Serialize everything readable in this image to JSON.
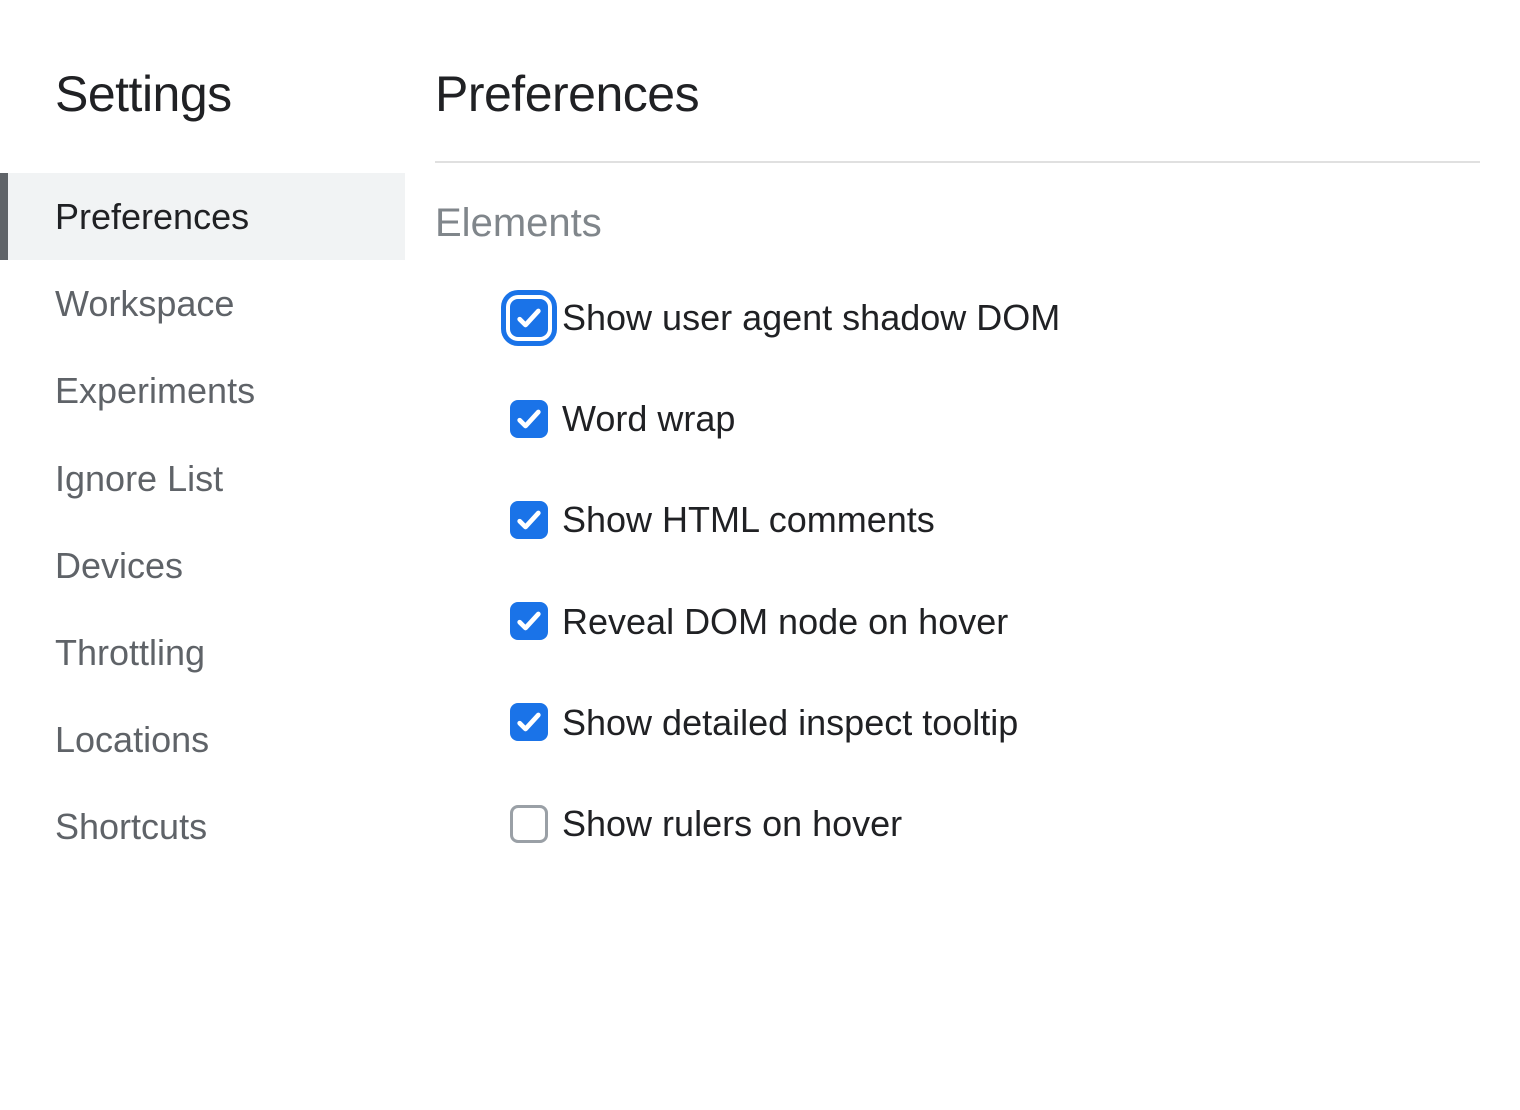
{
  "sidebar": {
    "title": "Settings",
    "items": [
      {
        "label": "Preferences",
        "active": true
      },
      {
        "label": "Workspace",
        "active": false
      },
      {
        "label": "Experiments",
        "active": false
      },
      {
        "label": "Ignore List",
        "active": false
      },
      {
        "label": "Devices",
        "active": false
      },
      {
        "label": "Throttling",
        "active": false
      },
      {
        "label": "Locations",
        "active": false
      },
      {
        "label": "Shortcuts",
        "active": false
      }
    ]
  },
  "main": {
    "title": "Preferences",
    "section": {
      "title": "Elements",
      "options": [
        {
          "label": "Show user agent shadow DOM",
          "checked": true,
          "focused": true
        },
        {
          "label": "Word wrap",
          "checked": true,
          "focused": false
        },
        {
          "label": "Show HTML comments",
          "checked": true,
          "focused": false
        },
        {
          "label": "Reveal DOM node on hover",
          "checked": true,
          "focused": false
        },
        {
          "label": "Show detailed inspect tooltip",
          "checked": true,
          "focused": false
        },
        {
          "label": "Show rulers on hover",
          "checked": false,
          "focused": false
        }
      ]
    }
  }
}
